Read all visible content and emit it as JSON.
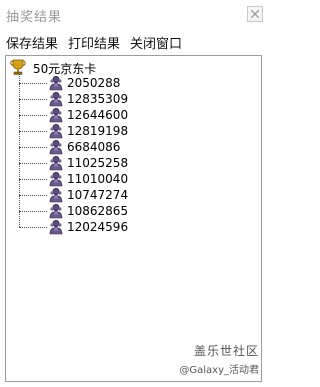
{
  "window": {
    "title": "抽奖结果"
  },
  "menu": {
    "items": [
      "保存结果",
      "打印结果",
      "关闭窗口"
    ]
  },
  "tree": {
    "root_label": "50元京东卡",
    "root_icon": "trophy-icon",
    "children_icon": "user-icon",
    "children": [
      "2050288",
      "12835309",
      "12644600",
      "12819198",
      "6684086",
      "11025258",
      "11010040",
      "10747274",
      "10862865",
      "12024596"
    ]
  },
  "watermark": {
    "line1": "盖乐世社区",
    "line2": "@Galaxy_活动君"
  },
  "colors": {
    "title_text": "#9a9a9a",
    "trophy": "#c89a1a",
    "user_icon": "#4a3a6a"
  }
}
